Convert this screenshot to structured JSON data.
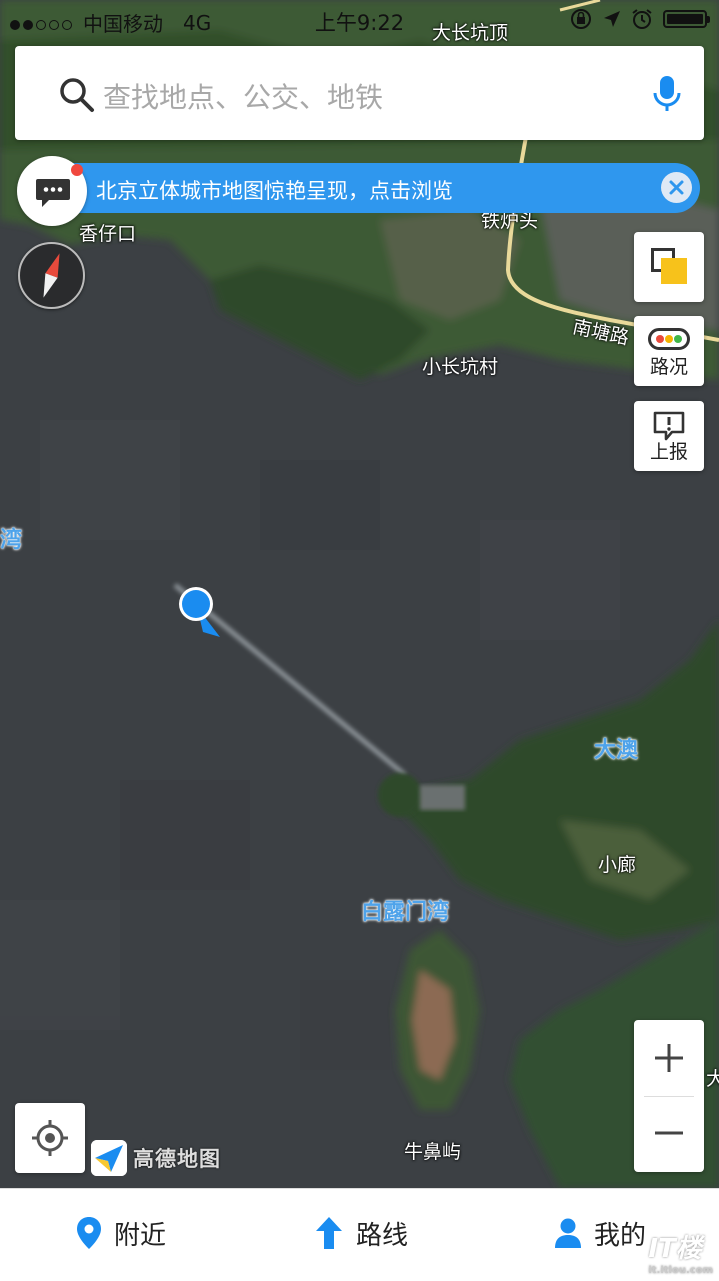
{
  "status_bar": {
    "carrier": "中国移动",
    "network": "4G",
    "time": "上午9:22",
    "signal_bars": 2
  },
  "search": {
    "placeholder": "查找地点、公交、地铁",
    "icon": "search-icon",
    "voice_icon": "microphone-icon"
  },
  "notice": {
    "text": "北京立体城市地图惊艳呈现，点击浏览",
    "has_unread": true
  },
  "map": {
    "mode": "satellite",
    "places": [
      "大长坑顶",
      "香仔口",
      "铁炉头",
      "南塘路",
      "小长坑村",
      "小廊",
      "牛鼻屿",
      "大官"
    ],
    "water_labels": [
      "湾",
      "大澳",
      "白露门湾"
    ]
  },
  "tools": {
    "traffic_label": "路况",
    "report_label": "上报",
    "traffic_colors": [
      "#e84a3c",
      "#f5b400",
      "#41b649"
    ],
    "accent": "#1a8cf0",
    "layer_color": "#f7c21b"
  },
  "brand": {
    "name": "高德地图"
  },
  "tabs": {
    "nearby": "附近",
    "route": "路线",
    "mine": "我的"
  },
  "watermark": {
    "main": "IT楼",
    "sub": "it.itlou.com"
  }
}
